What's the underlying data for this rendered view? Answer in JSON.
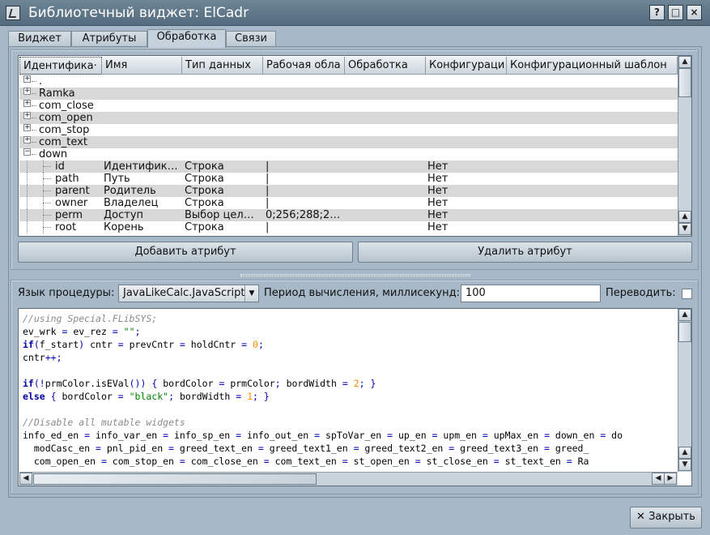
{
  "window": {
    "title": "Библиотечный виджет: ElCadr",
    "controls": [
      "?",
      "□",
      "×"
    ]
  },
  "tabs": [
    {
      "label": "Виджет"
    },
    {
      "label": "Атрибуты"
    },
    {
      "label": "Обработка"
    },
    {
      "label": "Связи"
    }
  ],
  "table": {
    "columns": [
      "Идентифика·",
      "Имя",
      "Тип данных",
      "Рабочая обла",
      "Обработка",
      "Конфигураци",
      "Конфигурационный шаблон"
    ],
    "rows": [
      {
        "id": ".",
        "expander": "+",
        "level": 0
      },
      {
        "id": "Ramka",
        "expander": "+",
        "level": 0
      },
      {
        "id": "com_close",
        "expander": "+",
        "level": 0
      },
      {
        "id": "com_open",
        "expander": "+",
        "level": 0
      },
      {
        "id": "com_stop",
        "expander": "+",
        "level": 0
      },
      {
        "id": "com_text",
        "expander": "+",
        "level": 0
      },
      {
        "id": "down",
        "expander": "−",
        "level": 0
      },
      {
        "id": "id",
        "name": "Идентифик…",
        "type": "Строка",
        "work": "|",
        "config": "Нет",
        "level": 1
      },
      {
        "id": "path",
        "name": "Путь",
        "type": "Строка",
        "work": "|",
        "config": "Нет",
        "level": 1
      },
      {
        "id": "parent",
        "name": "Родитель",
        "type": "Строка",
        "work": "|",
        "config": "Нет",
        "level": 1
      },
      {
        "id": "owner",
        "name": "Владелец",
        "type": "Строка",
        "work": "|",
        "config": "Нет",
        "level": 1
      },
      {
        "id": "perm",
        "name": "Доступ",
        "type": "Выбор цел…",
        "work": "0;256;288;2…",
        "config": "Нет",
        "level": 1
      },
      {
        "id": "root",
        "name": "Корень",
        "type": "Строка",
        "work": "|",
        "config": "Нет",
        "level": 1
      }
    ]
  },
  "buttons": {
    "add_attr": "Добавить атрибут",
    "del_attr": "Удалить атрибут",
    "close": "Закрыть"
  },
  "procedure": {
    "lang_label": "Язык процедуры:",
    "lang_value": "JavaLikeCalc.JavaScript",
    "period_label": "Период вычисления, миллисекунд:",
    "period_value": "100",
    "translate_label": "Переводить:",
    "translate_checked": false
  },
  "code_lines": [
    "//using Special.FLibSYS;",
    "ev_wrk = ev_rez = \"\";",
    "if(f_start) cntr = prevCntr = holdCntr = 0;",
    "cntr++;",
    "",
    "if(!prmColor.isEVal()) { bordColor = prmColor; bordWidth = 2; }",
    "else { bordColor = \"black\"; bordWidth = 1; }",
    "",
    "//Disable all mutable widgets",
    "info_ed_en = info_var_en = info_sp_en = info_out_en = spToVar_en = up_en = upm_en = upMax_en = down_en = do",
    "  modCasc_en = pnl_pid_en = greed_text_en = greed_text1_en = greed_text2_en = greed_text3_en = greed_",
    "  com_open_en = com_stop_en = com_close_en = com_text_en = st_open_en = st_close_en = st_text_en = Ra"
  ],
  "colors": {
    "background": "#a7b9c8",
    "titlebar": "#6e8596",
    "comment": "#8a8a8a",
    "keyword": "#0000a0",
    "number": "#ff8c00",
    "string": "#008000"
  }
}
